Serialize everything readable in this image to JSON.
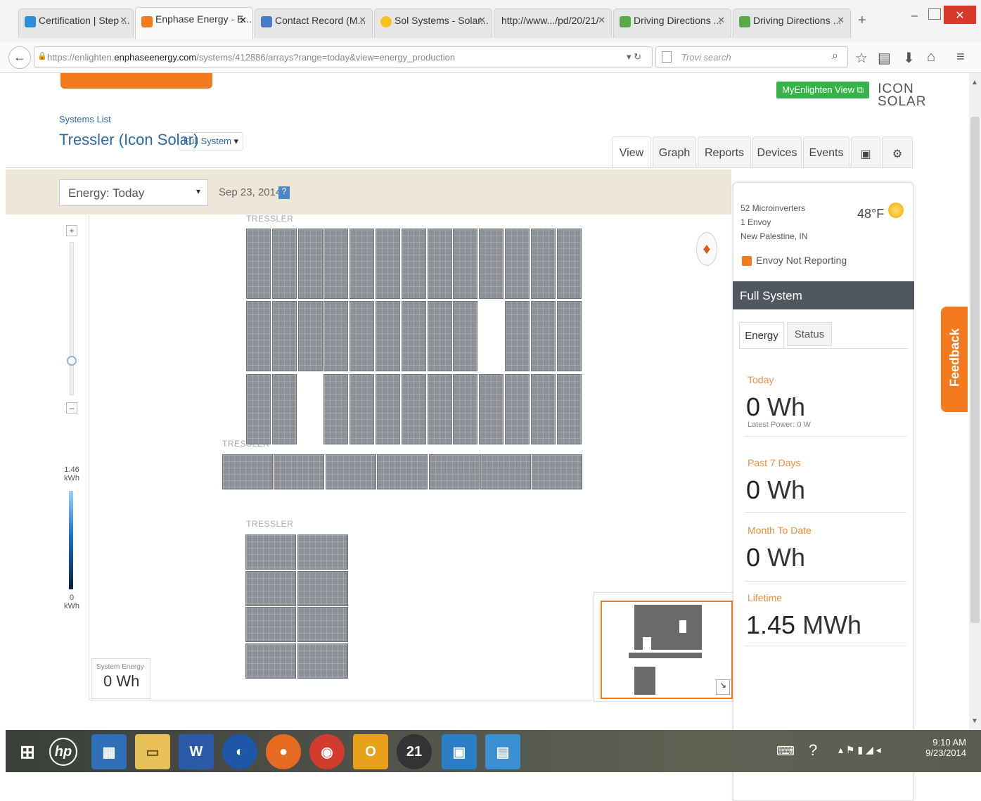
{
  "browser": {
    "tabs": [
      {
        "label": "Certification | Step ...",
        "color": "#2a8ed8"
      },
      {
        "label": "Enphase Energy - E...",
        "color": "#f47a20"
      },
      {
        "label": "Contact Record (M...",
        "color": "#4a7bc8"
      },
      {
        "label": "Sol Systems - Solar...",
        "color": "#f6c21c"
      },
      {
        "label": "http://www.../pd/20/21/",
        "color": "#e6e6e6"
      },
      {
        "label": "Driving Directions ...",
        "color": "#5ba84a"
      },
      {
        "label": "Driving Directions ...",
        "color": "#5ba84a"
      }
    ],
    "url_prefix": "https://enlighten.",
    "url_domain": "enphaseenergy.com",
    "url_path": "/systems/412886/arrays?range=today&view=energy_production",
    "search_placeholder": "Trovi search"
  },
  "header": {
    "myenlighten_label": "MyEnlighten View",
    "logo_line1": "ICON",
    "logo_line2": "SOLAR",
    "systems_list": "Systems List",
    "system_name": "Tressler (Icon Solar)",
    "system_scope": "Full System",
    "tabs": [
      "View",
      "Graph",
      "Reports",
      "Devices",
      "Events"
    ]
  },
  "toolbar": {
    "energy_select": "Energy: Today",
    "date": "Sep 23, 2014"
  },
  "map": {
    "group_label": "TRESSLER",
    "scale_max": "1.46",
    "scale_max_unit": "kWh",
    "scale_min": "0",
    "scale_min_unit": "kWh",
    "system_energy_label": "System Energy",
    "system_energy_value": "0 Wh"
  },
  "system_info": {
    "microinverters": "52 Microinverters",
    "envoy": "1 Envoy",
    "location": "New Palestine, IN",
    "temperature": "48°F",
    "envoy_status": "Envoy Not Reporting",
    "section_title": "Full System",
    "tabs": [
      "Energy",
      "Status"
    ],
    "stats": [
      {
        "label": "Today",
        "value": "0",
        "unit": "Wh",
        "sub": "Latest Power: 0 W"
      },
      {
        "label": "Past 7 Days",
        "value": "0",
        "unit": "Wh"
      },
      {
        "label": "Month To Date",
        "value": "0",
        "unit": "Wh"
      },
      {
        "label": "Lifetime",
        "value": "1.45",
        "unit": "MWh"
      }
    ]
  },
  "feedback_label": "Feedback",
  "taskbar": {
    "time": "9:10 AM",
    "date": "9/23/2014"
  }
}
